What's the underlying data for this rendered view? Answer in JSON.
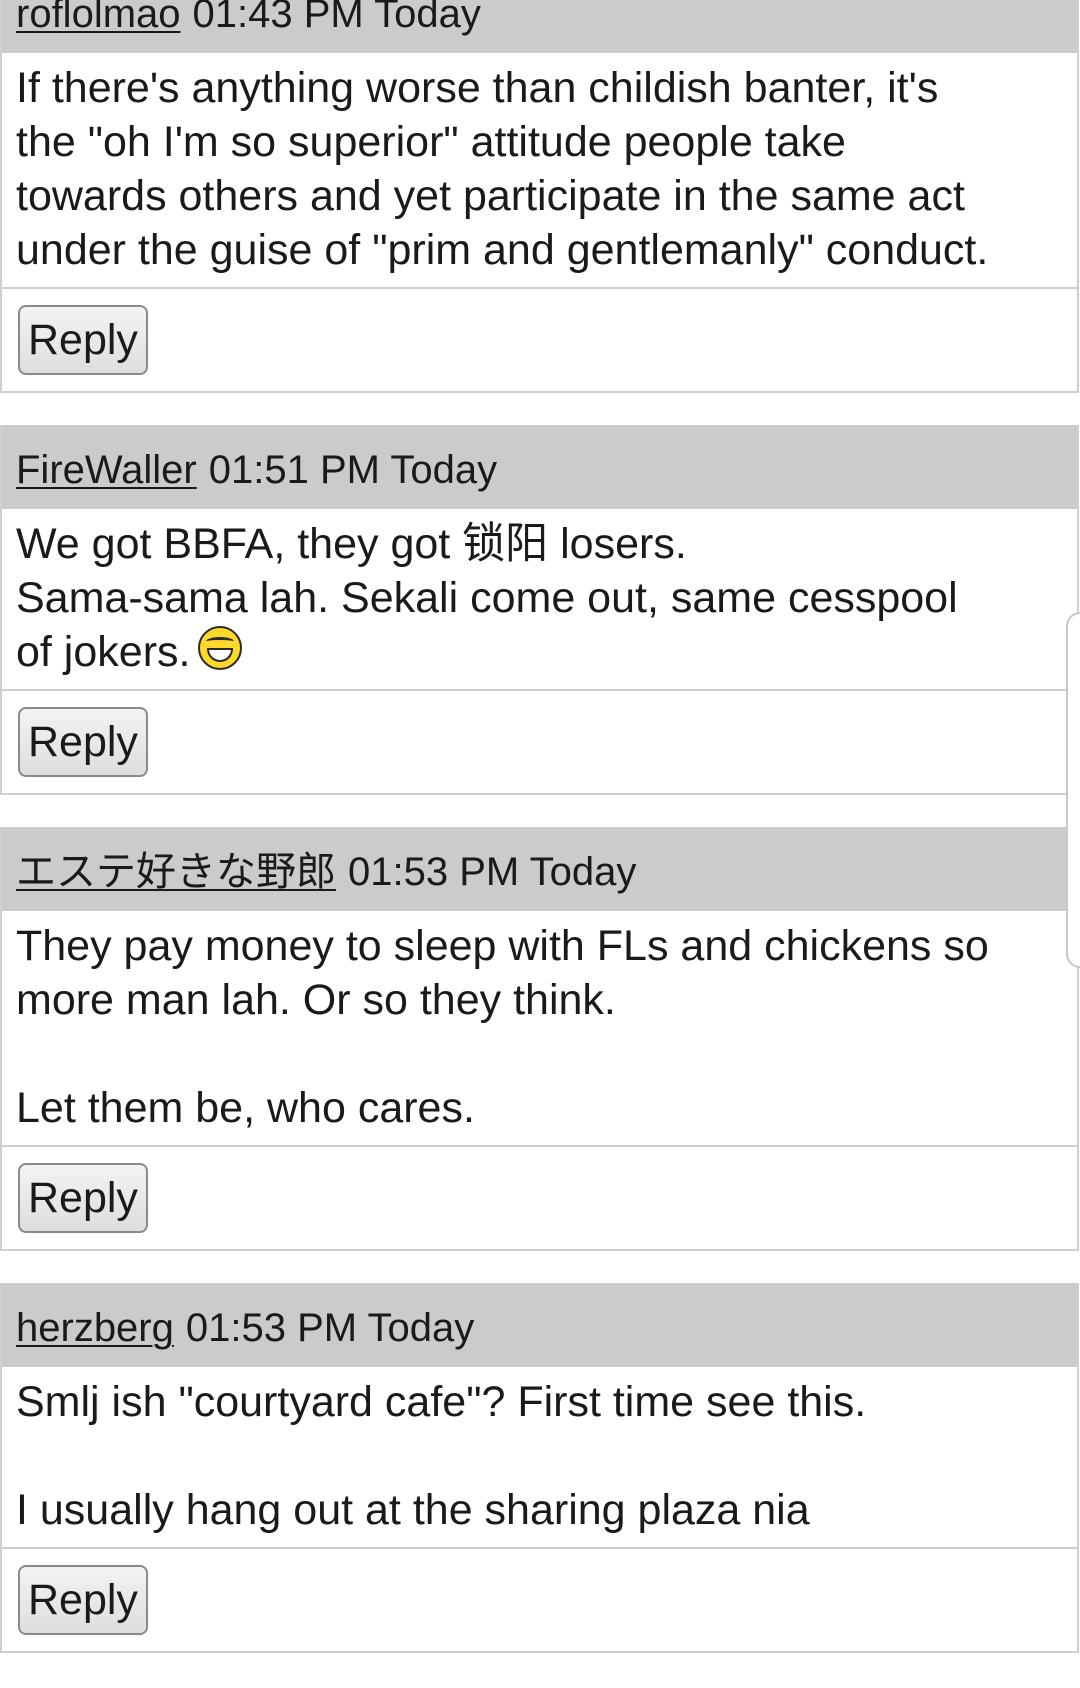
{
  "posts": [
    {
      "author": "roflolmao",
      "timestamp": "01:43 PM Today",
      "body": "If there's anything worse than childish banter, it's\nthe \"oh I'm so superior\" attitude people take\ntowards others and yet participate in the same act\nunder the guise of \"prim and gentlemanly\" conduct.",
      "reply_label": "Reply"
    },
    {
      "author": "FireWaller",
      "timestamp": "01:51 PM Today",
      "body_line1": "We got BBFA, they got 锁阳 losers.",
      "body_line2": "Sama-sama lah. Sekali come out, same cesspool",
      "body_line3": "of jokers.",
      "emoji_icon": "grinning-face-icon",
      "reply_label": "Reply"
    },
    {
      "author": "エステ好きな野郎",
      "timestamp": "01:53 PM Today",
      "body": "They pay money to sleep with FLs and chickens so\nmore man lah. Or so they think.\n\nLet them be, who cares.",
      "reply_label": "Reply"
    },
    {
      "author": "herzberg",
      "timestamp": "01:53 PM Today",
      "body": "Smlj ish \"courtyard cafe\"? First time see this.\n\nI usually hang out at the sharing plaza nia",
      "reply_label": "Reply"
    }
  ],
  "colors": {
    "header_bg": "#cbcbcb",
    "border": "#cfcfcf",
    "text": "#1a1a1a"
  }
}
